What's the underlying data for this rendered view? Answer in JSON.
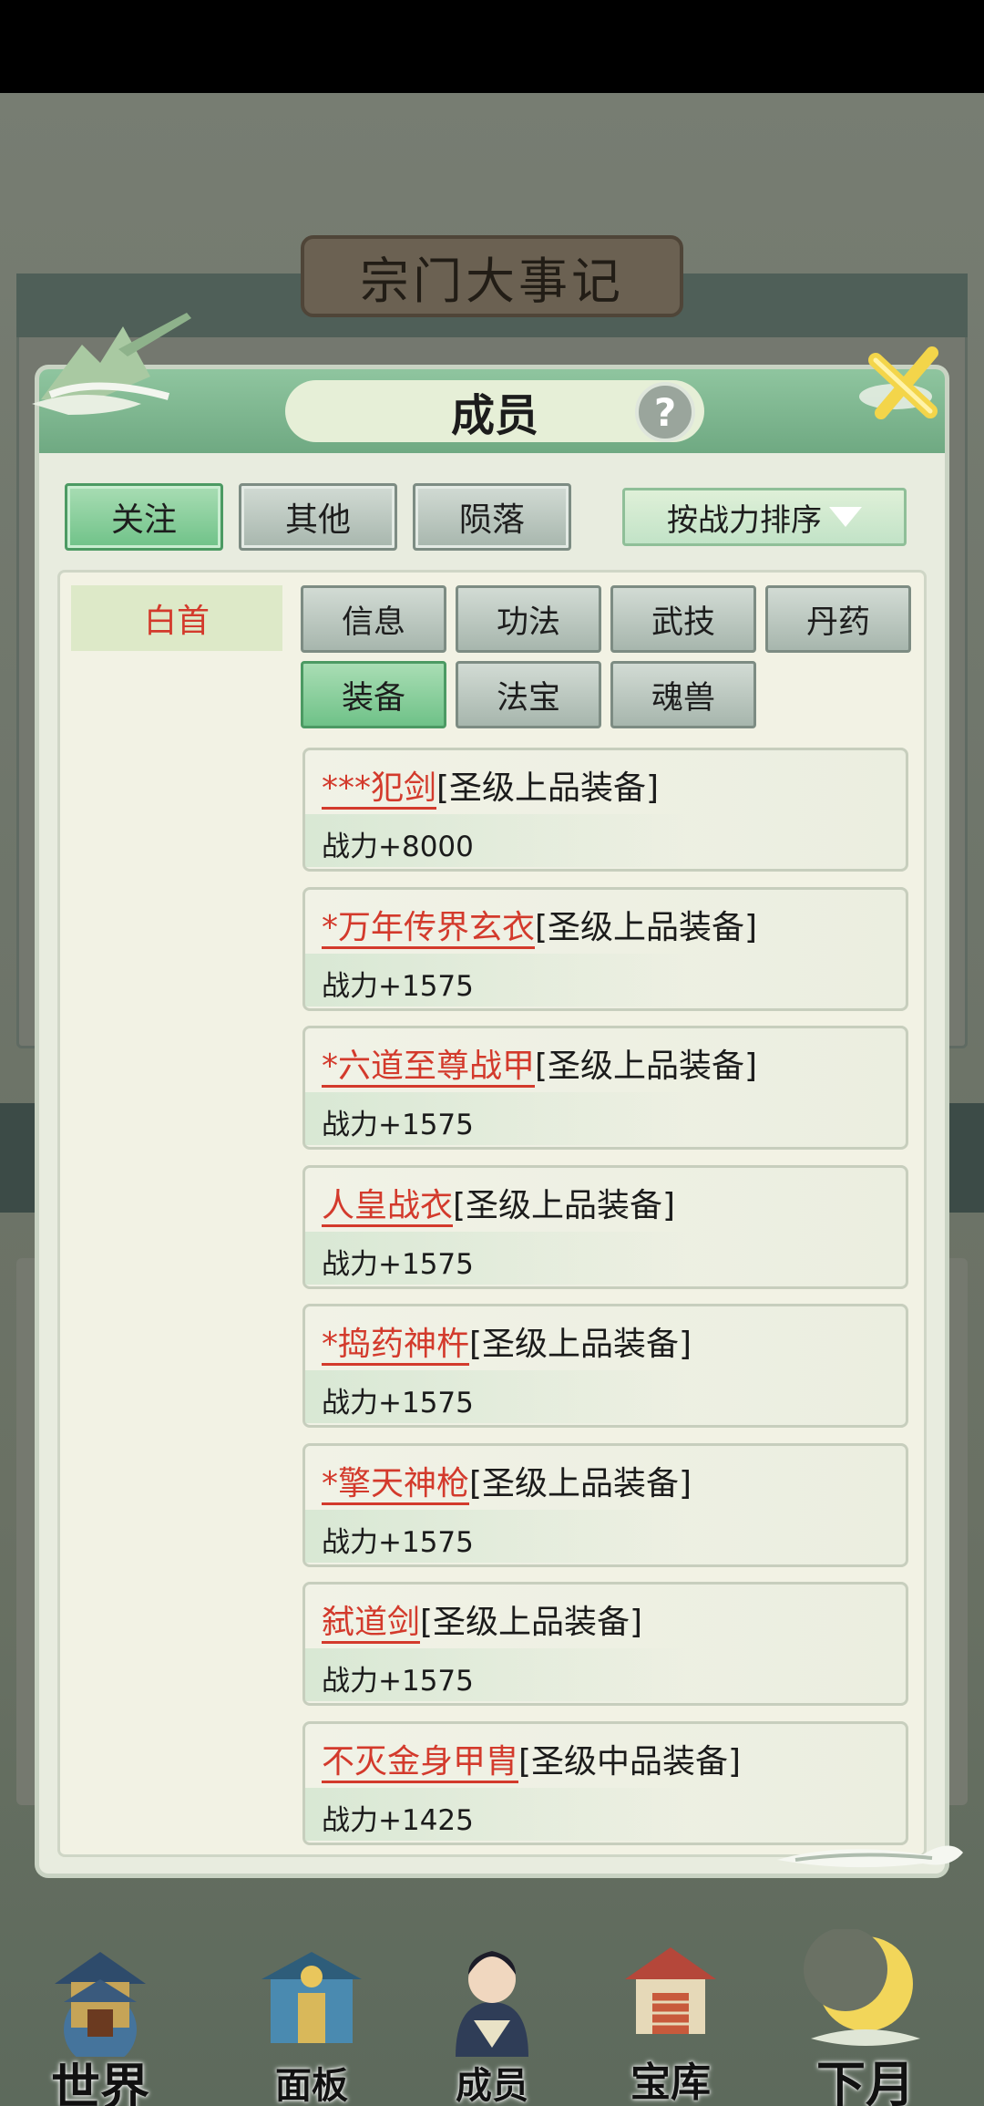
{
  "background": {
    "title": "宗门大事记"
  },
  "modal": {
    "title": "成员",
    "help_symbol": "?",
    "tabs": [
      {
        "label": "关注",
        "active": true
      },
      {
        "label": "其他",
        "active": false
      },
      {
        "label": "陨落",
        "active": false
      }
    ],
    "sort_label": "按战力排序",
    "member_name": "白首",
    "subtabs": [
      {
        "label": "信息",
        "active": false
      },
      {
        "label": "功法",
        "active": false
      },
      {
        "label": "武技",
        "active": false
      },
      {
        "label": "丹药",
        "active": false
      },
      {
        "label": "装备",
        "active": true
      },
      {
        "label": "法宝",
        "active": false
      },
      {
        "label": "魂兽",
        "active": false
      }
    ],
    "items": [
      {
        "name": "***犯剑",
        "grade": "[圣级上品装备]",
        "power": "战力+8000"
      },
      {
        "name": "*万年传界玄衣",
        "grade": "[圣级上品装备]",
        "power": "战力+1575"
      },
      {
        "name": "*六道至尊战甲",
        "grade": "[圣级上品装备]",
        "power": "战力+1575"
      },
      {
        "name": "人皇战衣",
        "grade": "[圣级上品装备]",
        "power": "战力+1575"
      },
      {
        "name": "*捣药神杵",
        "grade": "[圣级上品装备]",
        "power": "战力+1575"
      },
      {
        "name": "*擎天神枪",
        "grade": "[圣级上品装备]",
        "power": "战力+1575"
      },
      {
        "name": "弑道剑",
        "grade": "[圣级上品装备]",
        "power": "战力+1575"
      },
      {
        "name": "不灭金身甲胄",
        "grade": "[圣级中品装备]",
        "power": "战力+1425"
      }
    ]
  },
  "bottom_nav": [
    {
      "label": "世界",
      "icon": "pagoda-world-icon"
    },
    {
      "label": "面板",
      "icon": "gate-panel-icon"
    },
    {
      "label": "成员",
      "icon": "member-avatar-icon"
    },
    {
      "label": "宝库",
      "icon": "treasury-icon"
    },
    {
      "label": "下月",
      "icon": "crescent-moon-icon"
    }
  ],
  "colors": {
    "accent_green": "#6fc288",
    "item_name_red": "#d33a2c",
    "header_green": "#7fb792"
  }
}
